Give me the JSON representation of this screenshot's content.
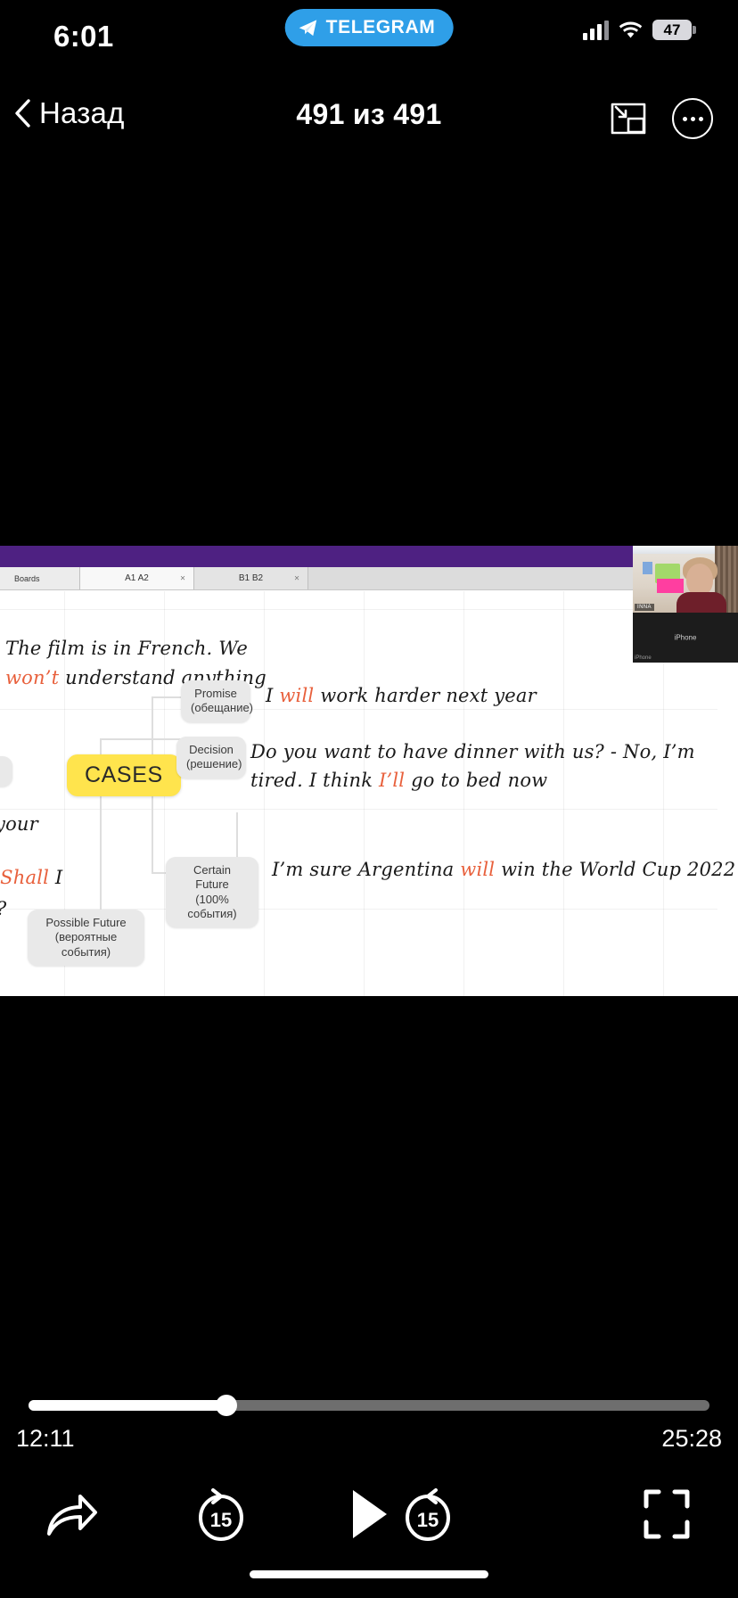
{
  "status_bar": {
    "time": "6:01",
    "app_pill_label": "TELEGRAM",
    "app_pill_icon": "telegram-plane-icon",
    "signal_icon": "cellular-signal-icon",
    "wifi_icon": "wifi-icon",
    "battery_level": "47",
    "accent": "#2f9fe8"
  },
  "nav_bar": {
    "back_label": "Назад",
    "back_icon": "chevron-left-icon",
    "title": "491 из 491",
    "pip_icon": "picture-in-picture-icon",
    "more_icon": "more-options-icon"
  },
  "video": {
    "browser": {
      "tabs": [
        {
          "label": "Boards",
          "closable": false,
          "active": false
        },
        {
          "label": "A1 A2",
          "closable": true,
          "active": true
        },
        {
          "label": "B1 B2",
          "closable": true,
          "active": false
        }
      ],
      "close_glyph": "×",
      "toolbar_color": "#4e2182"
    },
    "board": {
      "top_example": {
        "prefix": "The film is in French. We ",
        "highlight": "won’t",
        "suffix": " understand anything"
      },
      "center_node": {
        "label": "CASES",
        "color": "#ffe44d"
      },
      "branches": [
        {
          "title": "Promise",
          "subtitle": "(обещание)",
          "example_prefix": "I ",
          "example_highlight": "will",
          "example_suffix": " work harder next year"
        },
        {
          "title": "Decision",
          "subtitle": "(решение)",
          "example_line1_prefix": "Do you want to have dinner with us? - No, I’m",
          "example_line2_prefix": "tired. I think ",
          "example_line2_highlight": "I’ll",
          "example_line2_suffix": " go to bed now"
        },
        {
          "title": "Certain Future",
          "subtitle": "(100% события)",
          "example_prefix": "I’m sure Argentina ",
          "example_highlight": "will",
          "example_suffix": " win the World Cup 2022"
        },
        {
          "title": "Possible Future",
          "subtitle": "(вероятные события)",
          "example_prefix": "",
          "example_highlight": "",
          "example_suffix": ""
        }
      ],
      "clipped_left": {
        "line_a": "your",
        "line_b_highlight": "- Shall",
        "line_b_rest": " I",
        "line_c": "?"
      },
      "highlight_color": "#e8603c"
    },
    "webcam": {
      "participant_name": "INNA",
      "second_tile_label": "iPhone",
      "second_tile_corner": "iPhone"
    }
  },
  "player": {
    "current_time": "12:11",
    "duration": "25:28",
    "progress_percent": 29,
    "controls": [
      {
        "name": "share-icon",
        "label": ""
      },
      {
        "name": "rewind-15-icon",
        "label": "15"
      },
      {
        "name": "play-icon",
        "label": ""
      },
      {
        "name": "forward-15-icon",
        "label": "15"
      },
      {
        "name": "fullscreen-icon",
        "label": ""
      }
    ]
  }
}
